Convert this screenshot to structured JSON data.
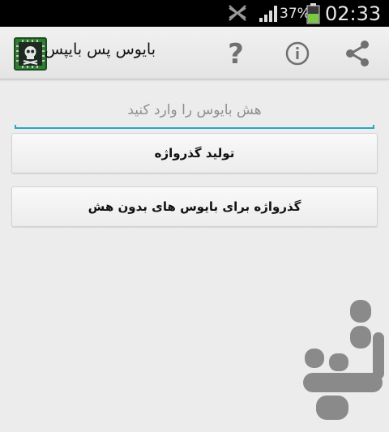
{
  "status_bar": {
    "battery_percent": "37%",
    "time": "02:33",
    "icons": [
      "mute-icon",
      "signal-icon",
      "battery-icon"
    ]
  },
  "action_bar": {
    "title": "بایوس پس بایپس",
    "icons": [
      "app-logo-icon",
      "help-icon",
      "info-icon",
      "share-icon"
    ]
  },
  "hash_input": {
    "placeholder": "هش بایوس را وارد کنید",
    "value": ""
  },
  "buttons": {
    "generate": "تولید گذرواژه",
    "no_hash": "گذرواژه برای بایوس های بدون هش"
  },
  "colors": {
    "accent": "#2ca3c7",
    "action_bar": "#e9e9e9",
    "background": "#ececec",
    "watermark": "#8a8a8a"
  }
}
